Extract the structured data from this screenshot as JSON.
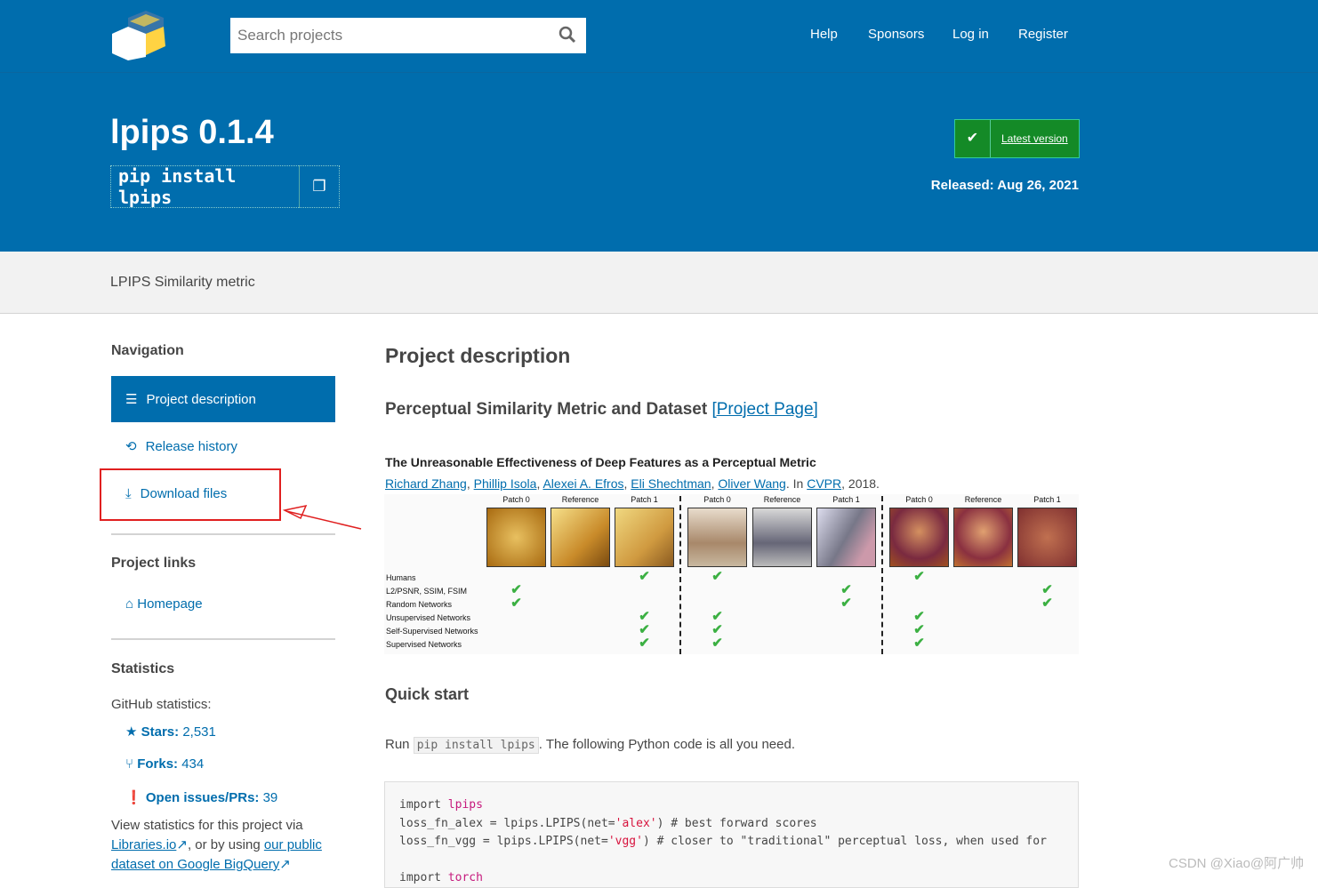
{
  "header": {
    "search_placeholder": "Search projects",
    "nav": [
      "Help",
      "Sponsors",
      "Log in",
      "Register"
    ]
  },
  "hero": {
    "title": "lpips 0.1.4",
    "install_cmd": "pip install lpips",
    "latest_label": "Latest version",
    "released": "Released: Aug 26, 2021"
  },
  "summary": "LPIPS Similarity metric",
  "sidebar": {
    "navigation_heading": "Navigation",
    "items": [
      "Project description",
      "Release history",
      "Download files"
    ],
    "project_links_heading": "Project links",
    "homepage": "Homepage",
    "statistics_heading": "Statistics",
    "github_label": "GitHub statistics:",
    "stars_label": "Stars:",
    "stars": "2,531",
    "forks_label": "Forks:",
    "forks": "434",
    "issues_label": "Open issues/PRs:",
    "issues": "39",
    "view_text": "View statistics for this project via",
    "libraries": "Libraries.io",
    "or_text": ", or by using",
    "public_dataset": "our public dataset on Google BigQuery"
  },
  "main": {
    "heading": "Project description",
    "subheading": "Perceptual Similarity Metric and Dataset",
    "project_page": "[Project Page]",
    "paper_title": "The Unreasonable Effectiveness of Deep Features as a Perceptual Metric",
    "authors": [
      "Richard Zhang",
      "Phillip Isola",
      "Alexei A. Efros",
      "Eli Shechtman",
      "Oliver Wang"
    ],
    "venue_prefix": ". In ",
    "venue": "CVPR",
    "year": ", 2018.",
    "figure": {
      "patch_labels": [
        "Patch 0",
        "Reference",
        "Patch 1",
        "Patch 0",
        "Reference",
        "Patch 1",
        "Patch 0",
        "Reference",
        "Patch 1"
      ],
      "rows": [
        "Humans",
        "L2/PSNR, SSIM, FSIM",
        "Random Networks",
        "Unsupervised Networks",
        "Self-Supervised Networks",
        "Supervised Networks"
      ],
      "checks": [
        [
          0,
          [
            1,
            2
          ]
        ],
        [
          2,
          [
            0,
            3,
            4,
            5
          ]
        ],
        [
          3,
          [
            0,
            3,
            4,
            5
          ]
        ],
        [
          5,
          [
            1,
            2
          ]
        ],
        [
          6,
          [
            0,
            3,
            4,
            5
          ]
        ],
        [
          8,
          [
            1,
            2
          ]
        ]
      ]
    },
    "quick_start": "Quick start",
    "run_prefix": "Run",
    "run_cmd": "pip install lpips",
    "run_suffix": ". The following Python code is all you need.",
    "code": [
      "import lpips",
      "loss_fn_alex = lpips.LPIPS(net='alex') # best forward scores",
      "loss_fn_vgg = lpips.LPIPS(net='vgg') # closer to \"traditional\" perceptual loss, when used for",
      "",
      "import torch"
    ]
  },
  "watermark": "CSDN @Xiao@阿广帅"
}
